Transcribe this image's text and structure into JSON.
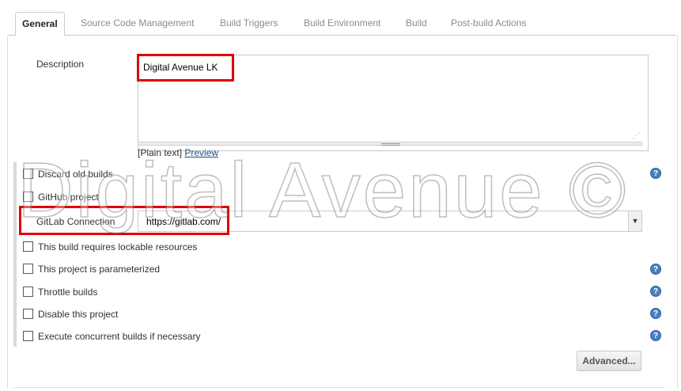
{
  "tabs": [
    "General",
    "Source Code Management",
    "Build Triggers",
    "Build Environment",
    "Build",
    "Post-build Actions"
  ],
  "description": {
    "label": "Description",
    "value": "Digital Avenue LK",
    "plain_text": "[Plain text]",
    "preview_link": "Preview"
  },
  "options": {
    "discard_old_builds": "Discard old builds",
    "github_project": "GitHub project",
    "lockable_resources": "This build requires lockable resources",
    "parameterized": "This project is parameterized",
    "throttle_builds": "Throttle builds",
    "disable_project": "Disable this project",
    "concurrent_builds": "Execute concurrent builds if necessary"
  },
  "gitlab": {
    "label": "GitLab Connection",
    "value": "https://gitlab.com/"
  },
  "buttons": {
    "advanced": "Advanced..."
  },
  "icons": {
    "help": "?",
    "dropdown": "▼"
  },
  "watermark": "Digital Avenue ©",
  "colors": {
    "highlight": "#e00000",
    "help": "#4a7fc1",
    "link": "#204a87"
  }
}
